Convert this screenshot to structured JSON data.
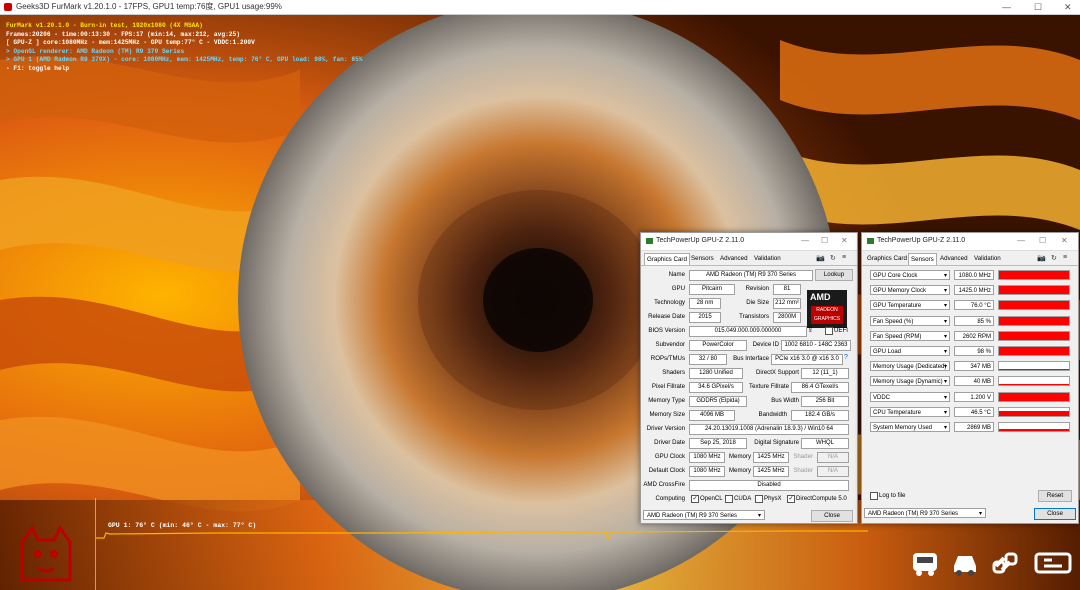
{
  "furmark": {
    "title_bar": "Geeks3D FurMark v1.20.1.0 - 17FPS, GPU1 temp:76度, GPU1 usage:99%",
    "osd_lines": [
      "FurMark v1.20.1.0 - Burn-in test, 1920x1080 (4X MSAA)",
      "Frames:20206 - time:00:13:30 - FPS:17 (min:14, max:212, avg:25)",
      "[ GPU-Z ] core:1080MHz - mem:1425MHz - GPU temp:77° C - VDDC:1.200V",
      "> OpenGL renderer: AMD Radeon (TM) R9 370 Series",
      "> GPU 1 (AMD Radeon R9 370X) - core: 1080MHz, mem: 1425MHz, temp: 76° C, GPU load: 98%, fan: 85%",
      "- F1: toggle help"
    ],
    "temp_graph_label": "GPU 1: 76° C (min: 46° C - max: 77° C)",
    "colors": {
      "osd_yellow": "#ffe600",
      "osd_cyan": "#66d9ff",
      "graph_line": "#ffb300"
    }
  },
  "gpuz_card": {
    "title": "TechPowerUp GPU-Z 2.11.0",
    "tabs": [
      "Graphics Card",
      "Sensors",
      "Advanced",
      "Validation"
    ],
    "active_tab": "Graphics Card",
    "logo_top": "AMD",
    "logo_bottom": "RADEON GRAPHICS",
    "lookup_label": "Lookup",
    "fields": {
      "name_label": "Name",
      "name": "AMD Radeon (TM) R9 370 Series",
      "gpu_label": "GPU",
      "gpu": "Pitcairn",
      "revision_label": "Revision",
      "revision": "81",
      "technology_label": "Technology",
      "technology": "28 nm",
      "die_size_label": "Die Size",
      "die_size": "212 mm²",
      "release_date_label": "Release Date",
      "release_date": "2015",
      "transistors_label": "Transistors",
      "transistors": "2800M",
      "bios_label": "BIOS Version",
      "bios": "015.049.000.009.000000",
      "uefi_label": "UEFI",
      "subvendor_label": "Subvendor",
      "subvendor": "PowerColor",
      "device_id_label": "Device ID",
      "device_id": "1002 6810 - 148C 2363",
      "rops_label": "ROPs/TMUs",
      "rops": "32 / 80",
      "bus_interface_label": "Bus Interface",
      "bus_interface": "PCIe x16 3.0 @ x16 3.0",
      "shaders_label": "Shaders",
      "shaders": "1280 Unified",
      "directx_label": "DirectX Support",
      "directx": "12 (11_1)",
      "pixel_fill_label": "Pixel Fillrate",
      "pixel_fill": "34.6 GPixel/s",
      "texture_fill_label": "Texture Fillrate",
      "texture_fill": "86.4 GTexel/s",
      "memory_type_label": "Memory Type",
      "memory_type": "GDDR5 (Elpida)",
      "bus_width_label": "Bus Width",
      "bus_width": "256 Bit",
      "memory_size_label": "Memory Size",
      "memory_size": "4096 MB",
      "bandwidth_label": "Bandwidth",
      "bandwidth": "182.4 GB/s",
      "driver_version_label": "Driver Version",
      "driver_version": "24.20.13019.1008 (Adrenalin 18.9.3) / Win10 64",
      "driver_date_label": "Driver Date",
      "driver_date": "Sep 25, 2018",
      "digital_signature_label": "Digital Signature",
      "digital_signature": "WHQL",
      "gpu_clock_label": "GPU Clock",
      "gpu_clock": "1080 MHz",
      "memory_label": "Memory",
      "gpu_memory_clock": "1425 MHz",
      "shader_label": "Shader",
      "shader_na": "N/A",
      "default_clock_label": "Default Clock",
      "default_clock": "1080 MHz",
      "default_memory_clock": "1425 MHz",
      "crossfire_label": "AMD CrossFire",
      "crossfire": "Disabled",
      "computing_label": "Computing",
      "opencl_label": "OpenCL",
      "cuda_label": "CUDA",
      "physx_label": "PhysX",
      "directcompute_label": "DirectCompute 5.0"
    },
    "computing_checked": {
      "opencl": true,
      "cuda": false,
      "physx": false,
      "directcompute": true
    },
    "select_value": "AMD Radeon (TM) R9 370 Series",
    "close_label": "Close"
  },
  "gpuz_sensors": {
    "title": "TechPowerUp GPU-Z 2.11.0",
    "tabs": [
      "Graphics Card",
      "Sensors",
      "Advanced",
      "Validation"
    ],
    "active_tab": "Sensors",
    "rows": [
      {
        "name": "GPU Core Clock",
        "value": "1080.0 MHz",
        "level": 0.95
      },
      {
        "name": "GPU Memory Clock",
        "value": "1425.0 MHz",
        "level": 0.95
      },
      {
        "name": "GPU Temperature",
        "value": "76.0 °C",
        "level": 0.93
      },
      {
        "name": "Fan Speed (%)",
        "value": "85 %",
        "level": 0.85
      },
      {
        "name": "Fan Speed (RPM)",
        "value": "2602 RPM",
        "level": 0.95
      },
      {
        "name": "GPU Load",
        "value": "98 %",
        "level": 0.98
      },
      {
        "name": "Memory Usage (Dedicated)",
        "value": "347 MB",
        "level": 0.12
      },
      {
        "name": "Memory Usage (Dynamic)",
        "value": "40 MB",
        "level": 0.04
      },
      {
        "name": "VDDC",
        "value": "1.200 V",
        "level": 0.9
      },
      {
        "name": "CPU Temperature",
        "value": "46.5 °C",
        "level": 0.45
      },
      {
        "name": "System Memory Used",
        "value": "2869 MB",
        "level": 0.2
      }
    ],
    "log_label": "Log to file",
    "reset_label": "Reset",
    "select_value": "AMD Radeon (TM) R9 370 Series",
    "close_label": "Close",
    "bar_color": "#ff0000"
  },
  "watermark": {
    "icons": [
      "bus-icon",
      "car-icon",
      "link-icon",
      "brand-logo"
    ]
  }
}
